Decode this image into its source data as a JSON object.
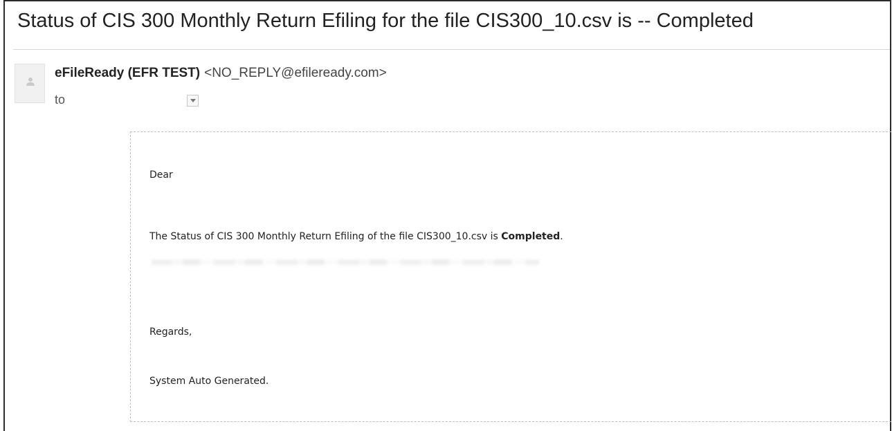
{
  "email": {
    "subject": "Status of CIS 300 Monthly Return Efiling for the file CIS300_10.csv is -- Completed",
    "sender": {
      "name": "eFileReady (EFR TEST)",
      "email": "<NO_REPLY@efileready.com>"
    },
    "to_label": "to",
    "icons": {
      "avatar": "person-avatar-icon",
      "details_toggle": "chevron-down-icon"
    },
    "body": {
      "greeting": "Dear",
      "status_prefix": "The Status of CIS 300 Monthly Return Efiling of the file CIS300_10.csv is ",
      "status_value": "Completed",
      "status_suffix": ".",
      "closing": "Regards,",
      "signature": "System Auto Generated."
    }
  }
}
